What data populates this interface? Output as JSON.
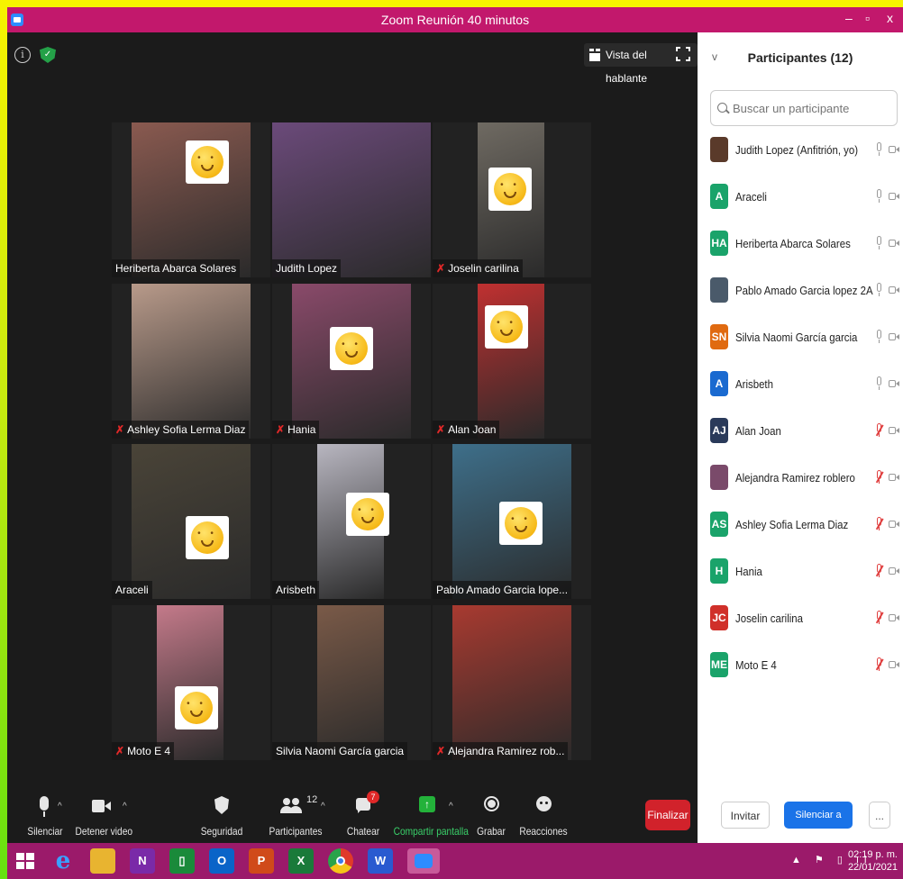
{
  "window": {
    "title": "Zoom Reunión 40 minutos",
    "minimize": "–",
    "restore": "▫",
    "close": "x"
  },
  "top": {
    "speaker_view": "Vista del hablante",
    "info_glyph": "i",
    "shield_glyph": "✓"
  },
  "tiles": [
    {
      "name": "Heriberta Abarca Solares",
      "muted": false,
      "bg": "#8a5a50",
      "active": false
    },
    {
      "name": "Judith Lopez",
      "muted": false,
      "bg": "#6b4a7a",
      "active": true
    },
    {
      "name": "Joselin carilina",
      "muted": true,
      "bg": "#6f6a62",
      "active": false
    },
    {
      "name": "Ashley Sofia Lerma Diaz",
      "muted": true,
      "bg": "#b89a8a",
      "active": false
    },
    {
      "name": "Hania",
      "muted": true,
      "bg": "#8a4a6a",
      "active": false
    },
    {
      "name": "Alan Joan",
      "muted": true,
      "bg": "#c03030",
      "active": false
    },
    {
      "name": "Araceli",
      "muted": false,
      "bg": "#4a4438",
      "active": false
    },
    {
      "name": "Arisbeth",
      "muted": false,
      "bg": "#b8b6c0",
      "active": false
    },
    {
      "name": "Pablo Amado Garcia lope...",
      "muted": false,
      "bg": "#3e6f8a",
      "active": false
    },
    {
      "name": "Moto E 4",
      "muted": true,
      "bg": "#c47a8a",
      "active": false
    },
    {
      "name": "Silvia Naomi García garcia",
      "muted": false,
      "bg": "#7a5a48",
      "active": false
    },
    {
      "name": "Alejandra Ramirez rob...",
      "muted": true,
      "bg": "#a83a30",
      "active": false
    }
  ],
  "toolbar": {
    "mute": "Silenciar",
    "video": "Detener video",
    "security": "Seguridad",
    "participants": "Participantes",
    "participants_count": "12",
    "chat": "Chatear",
    "chat_badge": "7",
    "share": "Compartir pantalla",
    "record": "Grabar",
    "reactions": "Reacciones",
    "end": "Finalizar",
    "caret": "^"
  },
  "panel": {
    "title": "Participantes (12)",
    "collapse_glyph": "v",
    "search_placeholder": "Buscar un participante",
    "participants": [
      {
        "initials": "",
        "name": "Judith Lopez (Anfitrión, yo)",
        "color": "#5a3a2a",
        "muted": false
      },
      {
        "initials": "A",
        "name": "Araceli",
        "color": "#1aa36a",
        "muted": false
      },
      {
        "initials": "HA",
        "name": "Heriberta Abarca Solares",
        "color": "#1aa36a",
        "muted": false
      },
      {
        "initials": "",
        "name": "Pablo Amado Garcia lopez 2A",
        "color": "#4a5a6a",
        "muted": false
      },
      {
        "initials": "SN",
        "name": "Silvia Naomi García garcia",
        "color": "#e06a10",
        "muted": false
      },
      {
        "initials": "A",
        "name": "Arisbeth",
        "color": "#1a6ad0",
        "muted": false
      },
      {
        "initials": "AJ",
        "name": "Alan Joan",
        "color": "#2a3a5a",
        "muted": true
      },
      {
        "initials": "",
        "name": "Alejandra Ramirez roblero",
        "color": "#7a4a6a",
        "muted": true
      },
      {
        "initials": "AS",
        "name": "Ashley Sofia Lerma Diaz",
        "color": "#1aa36a",
        "muted": true
      },
      {
        "initials": "H",
        "name": "Hania",
        "color": "#1aa36a",
        "muted": true
      },
      {
        "initials": "JC",
        "name": "Joselin carilina",
        "color": "#d0302a",
        "muted": true
      },
      {
        "initials": "ME",
        "name": "Moto E 4",
        "color": "#1aa36a",
        "muted": true
      }
    ],
    "invite": "Invitar",
    "mute_all": "Silenciar a todos",
    "more": "..."
  },
  "taskbar": {
    "time": "02:19 p. m.",
    "date": "22/01/2021",
    "tray": "▲ ⚑ ▯ ıl"
  }
}
